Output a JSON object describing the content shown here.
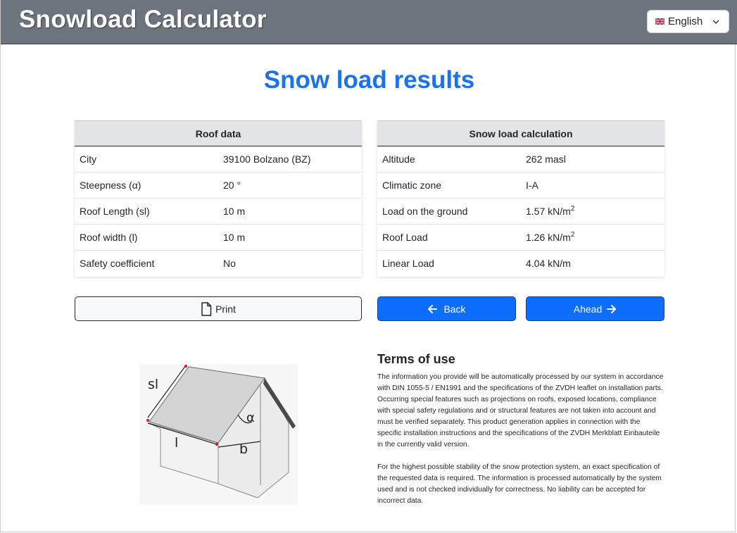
{
  "header": {
    "app_title": "Snowload Calculator",
    "language": "English"
  },
  "page_title": "Snow load results",
  "roof_data": {
    "heading": "Roof data",
    "rows": [
      {
        "label": "City",
        "value": "39100 Bolzano (BZ)"
      },
      {
        "label": "Steepness (α)",
        "value": "20 °"
      },
      {
        "label": "Roof Length (sl)",
        "value": "10 m"
      },
      {
        "label": "Roof width (l)",
        "value": "10 m"
      },
      {
        "label": "Safety coefficient",
        "value": "No"
      }
    ]
  },
  "snow_load": {
    "heading": "Snow load calculation",
    "rows": [
      {
        "label": "Altitude",
        "value": "262 masl",
        "sup": ""
      },
      {
        "label": "Climatic zone",
        "value": "I-A",
        "sup": ""
      },
      {
        "label": "Load on the ground",
        "value": "1.57 kN/m",
        "sup": "2"
      },
      {
        "label": "Roof Load",
        "value": "1.26 kN/m",
        "sup": "2"
      },
      {
        "label": "Linear Load",
        "value": "4.04 kN/m",
        "sup": ""
      }
    ]
  },
  "buttons": {
    "print": "Print",
    "back": "Back",
    "ahead": "Ahead"
  },
  "diagram": {
    "labels": {
      "sl": "sl",
      "l": "l",
      "b": "b",
      "alpha": "α"
    }
  },
  "terms": {
    "title": "Terms of use",
    "paragraph_1": "The information you provide will be automatically processed by our system in accordance with DIN 1055-5 / EN1991 and the specifications of the ZVDH leaflet on installation parts. Occurring special features such as projections on roofs, exposed locations, compliance with special safety regulations and or structural features are not taken into account and must be verified separately. This product generation applies in connection with the specific installation instructions and the specifications of the ZVDH Merkblatt Einbauteile in the currently valid version.",
    "paragraph_2": "For the highest possible stability of the snow protection system, an exact specification of the requested data is required. The information is processed automatically by the system used and is not checked individually for correctness. No liability can be accepted for incorrect data."
  },
  "colors": {
    "header_bg": "#6c757d",
    "title_blue": "#1a73e8",
    "primary_button": "#0d6efd",
    "table_head_bg": "#e3e4e6"
  }
}
